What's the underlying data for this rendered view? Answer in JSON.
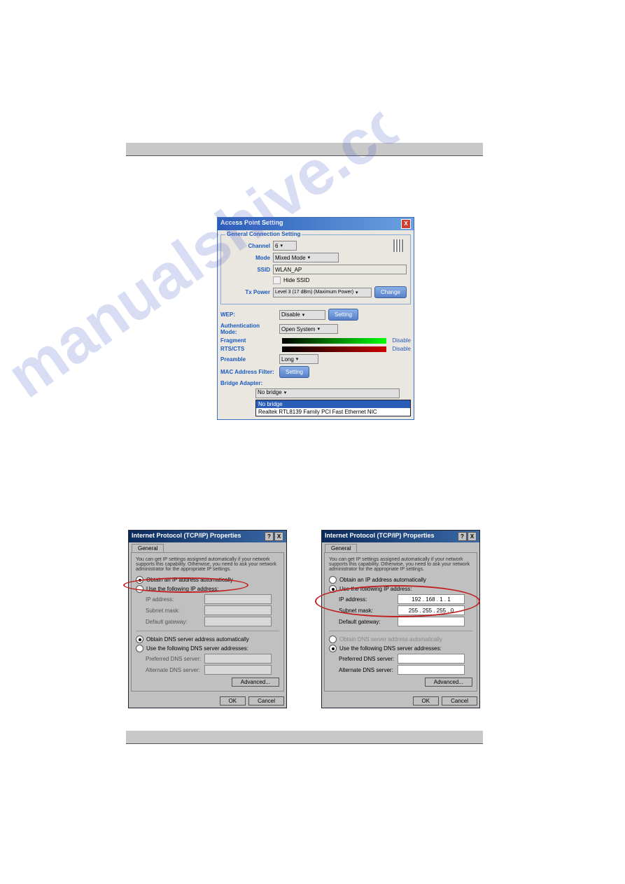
{
  "watermark": "manualshive.com",
  "ap": {
    "title": "Access Point Setting",
    "group": "General Connection Setting",
    "channel_label": "Channel",
    "channel_value": "6",
    "mode_label": "Mode",
    "mode_value": "Mixed Mode",
    "ssid_label": "SSID",
    "ssid_value": "WLAN_AP",
    "hide_ssid": "Hide SSID",
    "txpower_label": "Tx Power",
    "txpower_value": "Level 3 (17 dBm) (Maximum Power)",
    "change_btn": "Change",
    "wep_label": "WEP:",
    "wep_value": "Disable",
    "setting_btn": "Setting",
    "auth_label": "Authentication Mode:",
    "auth_value": "Open System",
    "fragment_label": "Fragment",
    "disable_txt": "Disable",
    "rtscts_label": "RTS/CTS",
    "preamble_label": "Preamble",
    "preamble_value": "Long",
    "mac_label": "MAC Address Filter:",
    "bridge_label": "Bridge Adapter:",
    "bridge_sel": "No bridge",
    "bridge_opt1": "No bridge",
    "bridge_opt2": "Realtek RTL8139 Family PCI Fast Ethernet NIC"
  },
  "tcp": {
    "title": "Internet Protocol (TCP/IP) Properties",
    "tab": "General",
    "desc": "You can get IP settings assigned automatically if your network supports this capability. Otherwise, you need to ask your network administrator for the appropriate IP settings.",
    "obtain_ip": "Obtain an IP address automatically",
    "use_ip": "Use the following IP address:",
    "ip_label": "IP address:",
    "subnet_label": "Subnet mask:",
    "gateway_label": "Default gateway:",
    "obtain_dns": "Obtain DNS server address automatically",
    "use_dns": "Use the following DNS server addresses:",
    "pref_dns": "Preferred DNS server:",
    "alt_dns": "Alternate DNS server:",
    "advanced": "Advanced...",
    "ok": "OK",
    "cancel": "Cancel",
    "right_ip": "192 . 168 .   1  .   1",
    "right_subnet": "255 . 255 . 255 .   0"
  }
}
